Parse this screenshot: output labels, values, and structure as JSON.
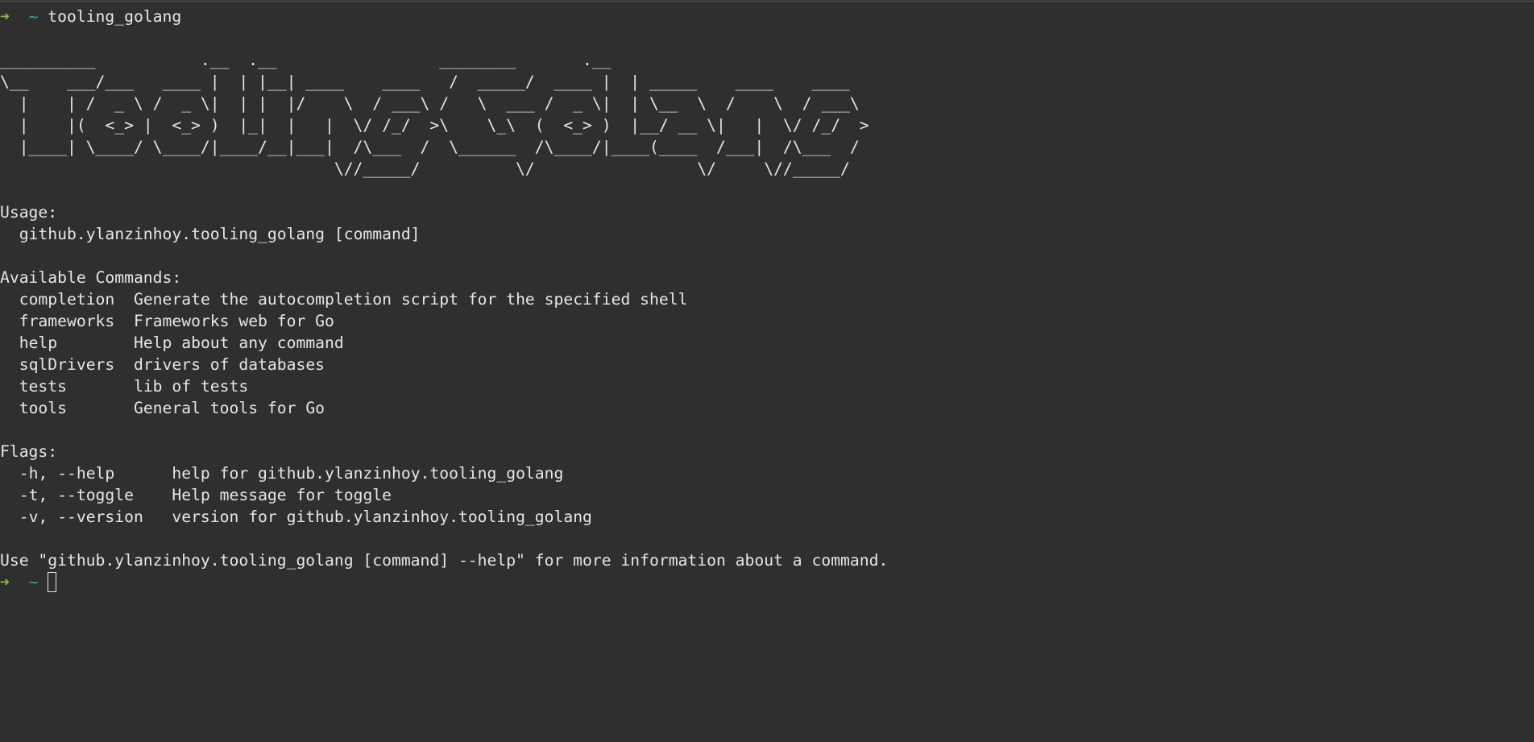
{
  "prompt": {
    "arrow": "➜",
    "dir": "~",
    "command": "tooling_golang"
  },
  "banner": [
    "__________           .__  .__                 ________       .__",
    "\\__    ___/___   ____ |  | |__| ____    ____   /  _____/  ____ |  | _____    ____    ____",
    "  |    | /  _ \\ /  _ \\|  | |  |/    \\  / ___\\ /   \\  ___ /  _ \\|  | \\__  \\  /    \\  / ___\\",
    "  |    |(  <_> |  <_> )  |_|  |   |  \\/ /_/  >\\    \\_\\  (  <_> )  |__/ __ \\|   |  \\/ /_/  >",
    "  |____| \\____/ \\____/|____/__|___|  /\\___  /  \\______  /\\____/|____(____  /___|  /\\___  /",
    "                                   \\//_____/          \\/                 \\/     \\//_____/"
  ],
  "usage": {
    "heading": "Usage:",
    "line": "github.ylanzinhoy.tooling_golang [command]"
  },
  "commands": {
    "heading": "Available Commands:",
    "items": [
      {
        "name": "completion",
        "desc": "Generate the autocompletion script for the specified shell"
      },
      {
        "name": "frameworks",
        "desc": "Frameworks web for Go"
      },
      {
        "name": "help",
        "desc": "Help about any command"
      },
      {
        "name": "sqlDrivers",
        "desc": "drivers of databases"
      },
      {
        "name": "tests",
        "desc": "lib of tests"
      },
      {
        "name": "tools",
        "desc": "General tools for Go"
      }
    ]
  },
  "flags": {
    "heading": "Flags:",
    "items": [
      {
        "name": "-h, --help",
        "desc": "help for github.ylanzinhoy.tooling_golang"
      },
      {
        "name": "-t, --toggle",
        "desc": "Help message for toggle"
      },
      {
        "name": "-v, --version",
        "desc": "version for github.ylanzinhoy.tooling_golang"
      }
    ]
  },
  "footer": "Use \"github.ylanzinhoy.tooling_golang [command] --help\" for more information about a command.",
  "colors": {
    "background": "#2f2f2f",
    "text": "#e6e6e6",
    "arrow": "#86c03a",
    "tilde": "#2aa7b8"
  }
}
